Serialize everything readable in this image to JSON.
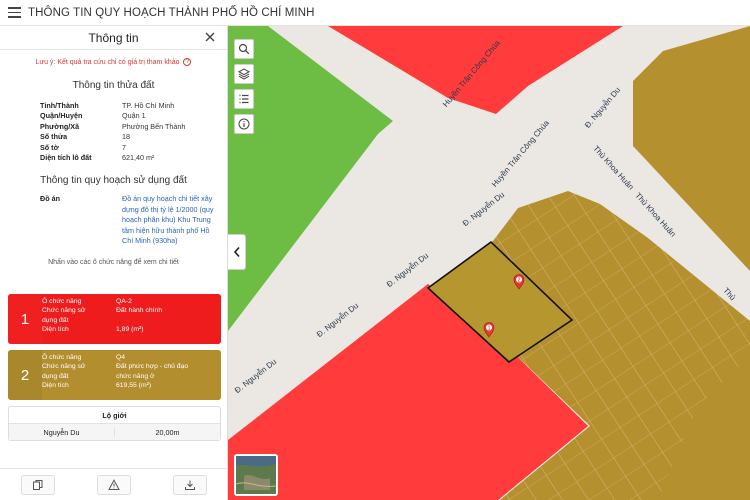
{
  "app": {
    "title": "THÔNG TIN QUY HOẠCH THÀNH PHỐ HỒ CHÍ MINH"
  },
  "panel": {
    "title": "Thông tin",
    "note": "Lưu ý: Kết quả tra cứu chỉ có giá trị tham khảo",
    "parcel_section_title": "Thông tin thửa đất",
    "parcel": [
      {
        "key": "Tỉnh/Thành",
        "value": "TP. Hồ Chí Minh"
      },
      {
        "key": "Quận/Huyện",
        "value": "Quận 1"
      },
      {
        "key": "Phường/Xã",
        "value": "Phường Bến Thành"
      },
      {
        "key": "Số thửa",
        "value": "18"
      },
      {
        "key": "Số tờ",
        "value": "7"
      },
      {
        "key": "Diện tích lô đất",
        "value": "621,40 m²"
      }
    ],
    "plan_section_title": "Thông tin quy hoạch sử dụng đất",
    "plan": {
      "key": "Đồ án",
      "value": "Đồ án quy hoạch chi tiết xây dựng đô thị tỷ lệ 1/2000 (quy hoạch phân khu) Khu Trung tâm hiện hữu thành phố Hồ Chí Minh (930ha)"
    },
    "hint": "Nhấn vào các ô chức năng để xem chi tiết",
    "cards": [
      {
        "number": "1",
        "color": "#ff2a2a",
        "rows": [
          {
            "key": "Ô chức năng",
            "value": "QA-2"
          },
          {
            "key": "Chức năng sử",
            "value": "Đất hành chính"
          },
          {
            "key": "dụng đất",
            "value": ""
          },
          {
            "key": "Diện tích",
            "value": "1,89 (m²)"
          }
        ]
      },
      {
        "number": "2",
        "color": "#b38e2e",
        "rows": [
          {
            "key": "Ô chức năng",
            "value": "Q4"
          },
          {
            "key": "Chức năng sử",
            "value": "Đất phức hợp - chủ đạo"
          },
          {
            "key": "dụng đất",
            "value": "chức năng ở"
          },
          {
            "key": "Diện tích",
            "value": "619,55 (m²)"
          }
        ]
      }
    ],
    "logioi": {
      "title": "Lộ giới",
      "street": "Nguyễn Du",
      "width": "20,00m"
    }
  },
  "map": {
    "streets": [
      {
        "name": "Huyền Trân Công Chúa"
      },
      {
        "name": "Huyền Trân Công Chúa"
      },
      {
        "name": "Đ. Nguyễn Du"
      },
      {
        "name": "Đ. Nguyễn Du"
      },
      {
        "name": "Đ. Nguyễn Du"
      },
      {
        "name": "Đ. Nguyễn Du"
      },
      {
        "name": "Đ. Nguyễn Du"
      },
      {
        "name": "Thủ Khoa Huân"
      },
      {
        "name": "Thủ Khoa Huân"
      },
      {
        "name": "Thủ"
      }
    ],
    "markers": [
      {
        "label": "1"
      },
      {
        "label": "2"
      }
    ],
    "colors": {
      "admin_land": "#ff3b3b",
      "mixed_use": "#b5902f",
      "green": "#6dbd45",
      "road": "#eae7e2"
    },
    "icons": [
      "search-icon",
      "layers-icon",
      "list-icon",
      "info-icon",
      "chevron-left-icon"
    ]
  },
  "footer": {
    "icons": [
      "copy-icon",
      "warning-icon",
      "download-icon"
    ]
  }
}
